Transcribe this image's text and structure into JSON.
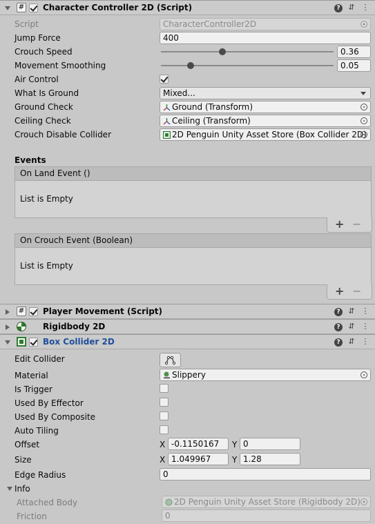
{
  "character_controller": {
    "title": "Character Controller 2D (Script)",
    "script_label": "Script",
    "script_value": "CharacterController2D",
    "jump_force_label": "Jump Force",
    "jump_force_value": "400",
    "crouch_speed_label": "Crouch Speed",
    "crouch_speed_value": "0.36",
    "movement_smoothing_label": "Movement Smoothing",
    "movement_smoothing_value": "0.05",
    "air_control_label": "Air Control",
    "air_control_checked": true,
    "what_is_ground_label": "What Is Ground",
    "what_is_ground_value": "Mixed...",
    "ground_check_label": "Ground Check",
    "ground_check_value": "Ground (Transform)",
    "ceiling_check_label": "Ceiling Check",
    "ceiling_check_value": "Ceiling (Transform)",
    "crouch_disable_label": "Crouch Disable Collider",
    "crouch_disable_value": "2D Penguin Unity Asset Store (Box Collider 2D)"
  },
  "events": {
    "heading": "Events",
    "on_land_title": "On Land Event ()",
    "on_land_empty": "List is Empty",
    "on_crouch_title": "On Crouch Event (Boolean)",
    "on_crouch_empty": "List is Empty",
    "add_symbol": "+",
    "remove_symbol": "−"
  },
  "player_movement": {
    "title": "Player Movement (Script)"
  },
  "rigidbody": {
    "title": "Rigidbody 2D"
  },
  "box_collider": {
    "title": "Box Collider 2D",
    "edit_collider_label": "Edit Collider",
    "material_label": "Material",
    "material_value": "Slippery",
    "is_trigger_label": "Is Trigger",
    "used_by_effector_label": "Used By Effector",
    "used_by_composite_label": "Used By Composite",
    "auto_tiling_label": "Auto Tiling",
    "offset_label": "Offset",
    "offset_x": "-0.1150167",
    "offset_y": "0",
    "size_label": "Size",
    "size_x": "1.049967",
    "size_y": "1.28",
    "edge_radius_label": "Edge Radius",
    "edge_radius_value": "0",
    "x_label": "X",
    "y_label": "Y"
  },
  "info": {
    "label": "Info",
    "attached_body_label": "Attached Body",
    "attached_body_value": "2D Penguin Unity Asset Store (Rigidbody 2D)",
    "friction_label": "Friction",
    "friction_value": "0"
  },
  "colors": {
    "panel_bg": "#c8c8c8",
    "selected_title": "#1f4f9c",
    "component_icon_green": "#2e7d32"
  }
}
